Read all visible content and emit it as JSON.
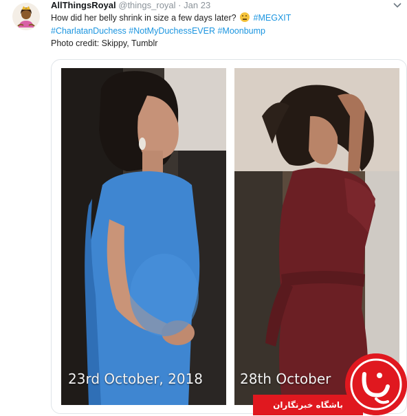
{
  "tweet": {
    "author_name": "AllThingsRoyal",
    "handle": "@things_royal",
    "separator": "·",
    "date": "Jan 23",
    "text_part1": "How did her belly shrink in size a few days later?",
    "hashtag_megxit": "#MEGXIT",
    "hashtags_line2": "#CharlatanDuchess #NotMyDuchessEVER #Moonbump",
    "photo_credit": "Photo credit: Skippy, Tumblr",
    "icons": {
      "avatar": "avatar-illustration",
      "menu": "chevron-down-icon",
      "emoji": "thinking-face-emoji"
    }
  },
  "media": {
    "left_caption": "23rd October, 2018",
    "right_caption": "28th October"
  },
  "watermark": {
    "text": "باشگاه خبرنگاران",
    "color": "#e0181f"
  }
}
